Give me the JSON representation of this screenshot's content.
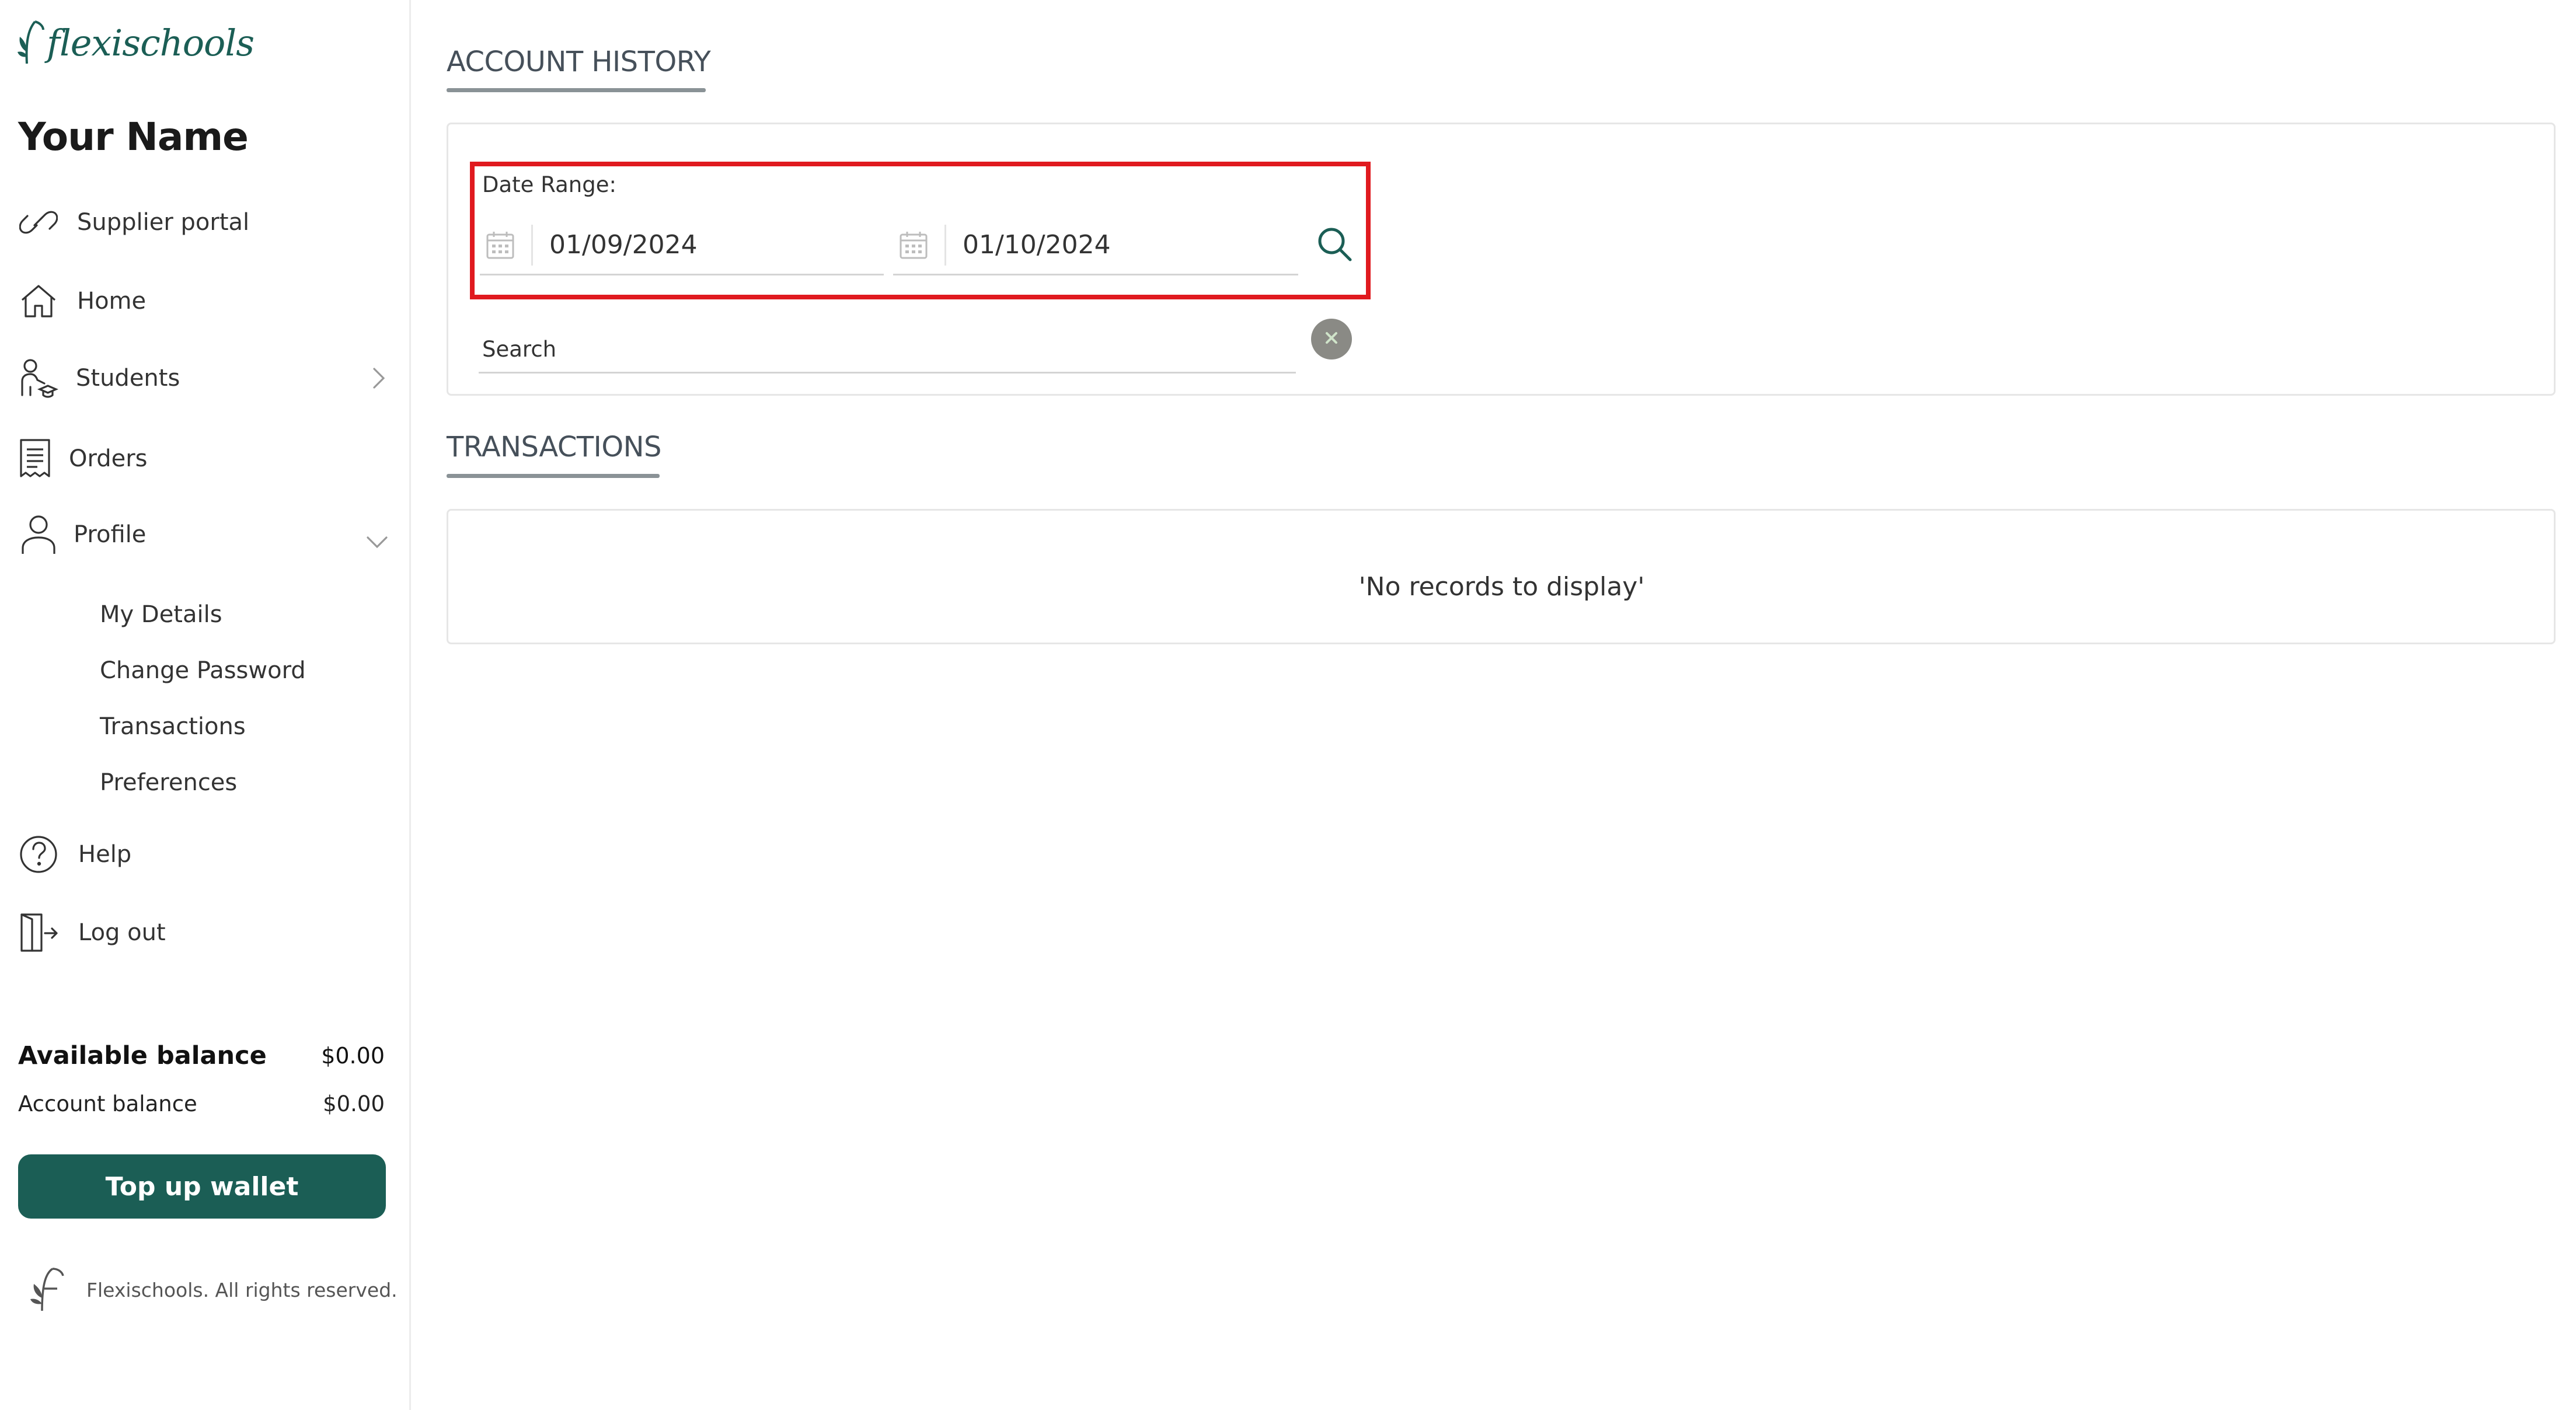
{
  "app": {
    "logo_text": "flexischools"
  },
  "sidebar": {
    "user_name": "Your Name",
    "nav": {
      "supplier_portal": "Supplier portal",
      "home": "Home",
      "students": "Students",
      "orders": "Orders",
      "profile": "Profile",
      "help": "Help",
      "logout": "Log out"
    },
    "profile_sub": {
      "my_details": "My Details",
      "change_password": "Change Password",
      "transactions": "Transactions",
      "preferences": "Preferences"
    },
    "balance": {
      "available_label": "Available balance",
      "available_value": "$0.00",
      "account_label": "Account balance",
      "account_value": "$0.00"
    },
    "topup_label": "Top up wallet",
    "footer_text": "Flexischools. All rights reserved."
  },
  "main": {
    "account_history_title": "ACCOUNT HISTORY",
    "date_range_label": "Date Range:",
    "date_from": "01/09/2024",
    "date_to": "01/10/2024",
    "search_placeholder": "Search",
    "transactions_title": "TRANSACTIONS",
    "empty_message": "'No records to display'"
  },
  "colors": {
    "brand": "#1b5e55",
    "highlight": "#e01a1f",
    "clear_button": "#8a8a85"
  },
  "icons": {
    "supplier_portal": "link-icon",
    "home": "home-icon",
    "students": "student-icon",
    "orders": "receipt-icon",
    "profile": "person-icon",
    "help": "help-icon",
    "logout": "logout-icon",
    "calendar": "calendar-icon",
    "search": "search-icon",
    "clear": "close-icon"
  }
}
